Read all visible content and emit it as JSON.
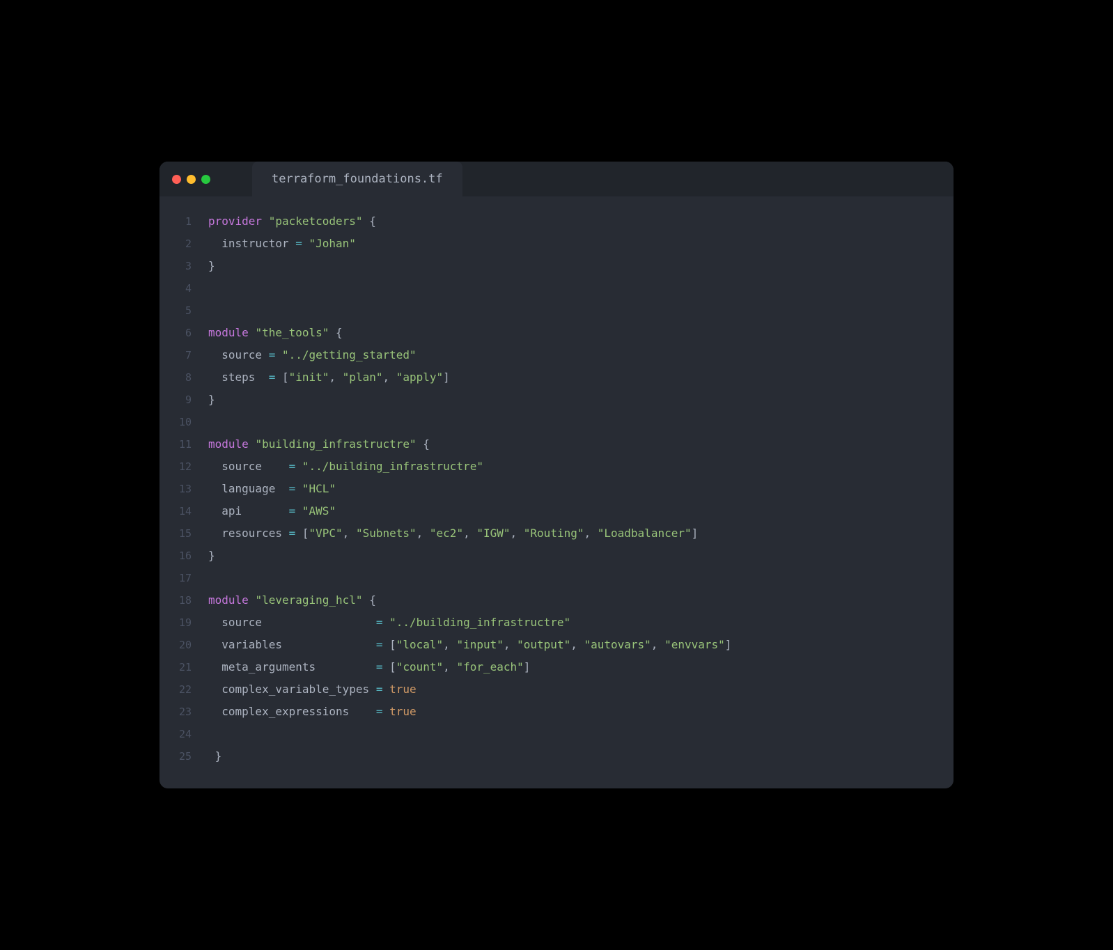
{
  "tab": {
    "filename": "terraform_foundations.tf"
  },
  "lines": {
    "l1": {
      "num": "1",
      "kw": "provider",
      "str": "\"packetcoders\"",
      "brace": " {"
    },
    "l2": {
      "num": "2",
      "ident": "  instructor ",
      "op": "=",
      "str": " \"Johan\""
    },
    "l3": {
      "num": "3",
      "brace": "}"
    },
    "l4": {
      "num": "4"
    },
    "l5": {
      "num": "5"
    },
    "l6": {
      "num": "6",
      "kw": "module",
      "str": "\"the_tools\"",
      "brace": " {"
    },
    "l7": {
      "num": "7",
      "ident": "  source ",
      "op": "=",
      "str": " \"../getting_started\""
    },
    "l8": {
      "num": "8",
      "ident": "  steps  ",
      "op": "=",
      "b1": " [",
      "s1": "\"init\"",
      "c1": ", ",
      "s2": "\"plan\"",
      "c2": ", ",
      "s3": "\"apply\"",
      "b2": "]"
    },
    "l9": {
      "num": "9",
      "brace": "}"
    },
    "l10": {
      "num": "10"
    },
    "l11": {
      "num": "11",
      "kw": "module",
      "str": "\"building_infrastructre\"",
      "brace": " {"
    },
    "l12": {
      "num": "12",
      "ident": "  source    ",
      "op": "=",
      "str": " \"../building_infrastructre\""
    },
    "l13": {
      "num": "13",
      "ident": "  language  ",
      "op": "=",
      "str": " \"HCL\""
    },
    "l14": {
      "num": "14",
      "ident": "  api       ",
      "op": "=",
      "str": " \"AWS\""
    },
    "l15": {
      "num": "15",
      "ident": "  resources ",
      "op": "=",
      "b1": " [",
      "s1": "\"VPC\"",
      "c1": ", ",
      "s2": "\"Subnets\"",
      "c2": ", ",
      "s3": "\"ec2\"",
      "c3": ", ",
      "s4": "\"IGW\"",
      "c4": ", ",
      "s5": "\"Routing\"",
      "c5": ", ",
      "s6": "\"Loadbalancer\"",
      "b2": "]"
    },
    "l16": {
      "num": "16",
      "brace": "}"
    },
    "l17": {
      "num": "17"
    },
    "l18": {
      "num": "18",
      "kw": "module",
      "str": "\"leveraging_hcl\"",
      "brace": " {"
    },
    "l19": {
      "num": "19",
      "ident": "  source                 ",
      "op": "=",
      "str": " \"../building_infrastructre\""
    },
    "l20": {
      "num": "20",
      "ident": "  variables              ",
      "op": "=",
      "b1": " [",
      "s1": "\"local\"",
      "c1": ", ",
      "s2": "\"input\"",
      "c2": ", ",
      "s3": "\"output\"",
      "c3": ", ",
      "s4": "\"autovars\"",
      "c4": ", ",
      "s5": "\"envvars\"",
      "b2": "]"
    },
    "l21": {
      "num": "21",
      "ident": "  meta_arguments         ",
      "op": "=",
      "b1": " [",
      "s1": "\"count\"",
      "c1": ", ",
      "s2": "\"for_each\"",
      "b2": "]"
    },
    "l22": {
      "num": "22",
      "ident": "  complex_variable_types ",
      "op": "=",
      "sp": " ",
      "bool": "true"
    },
    "l23": {
      "num": "23",
      "ident": "  complex_expressions    ",
      "op": "=",
      "sp": " ",
      "bool": "true"
    },
    "l24": {
      "num": "24"
    },
    "l25": {
      "num": "25",
      "brace": " }"
    }
  }
}
